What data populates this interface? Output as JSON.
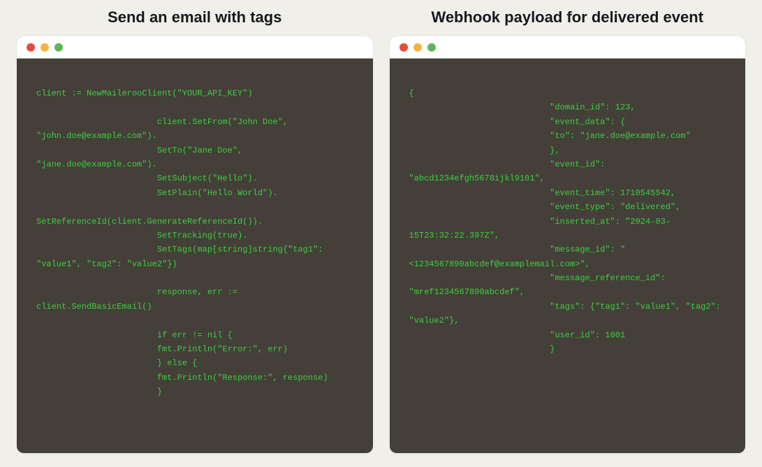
{
  "panels": {
    "left": {
      "title": "Send an email with tags",
      "code": "client := NewMailerooClient(\"YOUR_API_KEY\")\n\n                        client.SetFrom(\"John Doe\", \"john.doe@example.com\").\n                        SetTo(\"Jane Doe\", \"jane.doe@example.com\").\n                        SetSubject(\"Hello\").\n                        SetPlain(\"Hello World\").\n                        SetReferenceId(client.GenerateReferenceId()).\n                        SetTracking(true).\n                        SetTags(map[string]string{\"tag1\": \"value1\", \"tag2\": \"value2\"})\n\n                        response, err := client.SendBasicEmail()\n\n                        if err != nil {\n                        fmt.Println(\"Error:\", err)\n                        } else {\n                        fmt.Println(\"Response:\", response)\n                        }"
    },
    "right": {
      "title": "Webhook payload for delivered event",
      "code": "{\n                            \"domain_id\": 123,\n                            \"event_data\": {\n                            \"to\": \"jane.doe@example.com\"\n                            },\n                            \"event_id\": \"abcd1234efgh5678ijkl9101\",\n                            \"event_time\": 1710545542,\n                            \"event_type\": \"delivered\",\n                            \"inserted_at\": \"2024-03-15T23:32:22.397Z\",\n                            \"message_id\": \"<1234567890abcdef@examplemail.com>\",\n                            \"message_reference_id\": \"mref1234567890abcdef\",\n                            \"tags\": {\"tag1\": \"value1\", \"tag2\": \"value2\"},\n                            \"user_id\": 1001\n                            }"
    }
  },
  "traffic_lights": {
    "red": "#e84b3a",
    "yellow": "#f3b342",
    "green": "#5cb75b"
  }
}
